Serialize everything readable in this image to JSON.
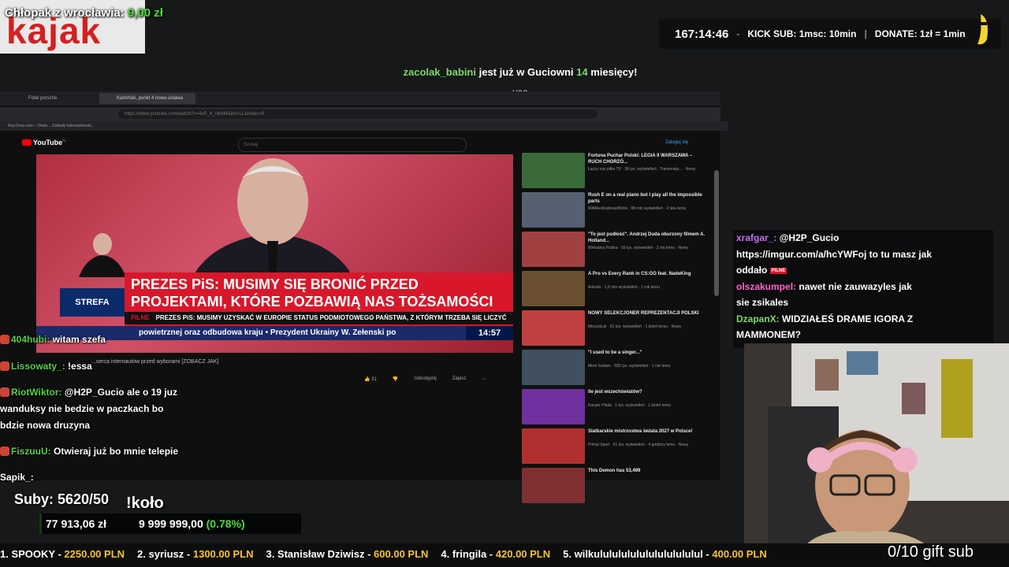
{
  "donation": {
    "logo": "kajak",
    "user": "Chłopak z wrocławia:",
    "amount": "9,00 zł"
  },
  "info_bar": {
    "timer": "167:14:46",
    "kick_sub": "KICK SUB: 1msc: 10min",
    "donate": "DONATE: 1zł = 1min"
  },
  "notification": {
    "user": "zacolak_babini",
    "text1": "jest już w Guciowni",
    "months": "14",
    "text2": "miesięcy!",
    "message": "yoo"
  },
  "browser": {
    "tabs": [
      "Fotel porsche",
      "Kamiński, punkt 4 nowa ustawa"
    ],
    "address": "https://www.youtube.com/watch?v=4oP_8_ctk4M&list=LL&index=8",
    "bookmarks": "Key-Drop.com – Otwie...   Zakłady bukmacherski...",
    "yt_logo": "YouTube",
    "yt_logo_country": "PL",
    "search_placeholder": "Szukaj",
    "login": "Zaloguj się"
  },
  "video": {
    "headline": "PREZES PiS: MUSIMY SIĘ BRONIĆ PRZED PROJEKTAMI, KTÓRE POZBAWIĄ NAS TOŻSAMOŚCI",
    "strefa": "STREFA",
    "pilne_tag": "PILNE",
    "pilne_text": "PREZES PiS: MUSIMY UZYSKAĆ W EUROPIE STATUS PODMIOTOWEGO PAŃSTWA, Z KTÓRYM TRZEBA SIĘ LICZYĆ",
    "ticker": "powietrznej oraz odbudowa kraju • Prezydent Ukrainy W. Zełenski po",
    "clock": "14:57",
    "title_below": "...serca internautów przed wyborami [ZOBACZ JAK]",
    "likes": "31",
    "share": "Udostępnij",
    "save": "Zapisz"
  },
  "sidebar": [
    {
      "title": "Fortuna Puchar Polski: LEGIA II WARSZAWA – RUCH CHORZÓ...",
      "meta": "Łączy nas piłka TV · 38 tys. wyświetleń · Transmisja... · Nowy"
    },
    {
      "title": "Rush E on a real piano but I play all the impossible parts",
      "meta": "WillAlsoKeyboardSlink · 88 mln wyświetleń · 2 lata temu"
    },
    {
      "title": "\"To jest podłość\". Andrzej Duda oburzony filmem A. Holland...",
      "meta": "Wirtualna Polska · 69 tys. wyświetleń · 2 dni temu · Nowy"
    },
    {
      "title": "A Pro vs Every Rank in CS:GO feat. NadeKing",
      "meta": "Astralis · 1,6 mln wyświetleń · 1 rok temu"
    },
    {
      "title": "NOWY SELEKCJONER REPREZENTACJI POLSKI",
      "meta": "Meczyki.pl · 51 tys. wyświetleń · 1 dzień temu · Nowy"
    },
    {
      "title": "\"I used to be a singer...\"",
      "meta": "Mere Guitars · 582 tys. wyświetleń · 1 rok temu"
    },
    {
      "title": "Ile jest wszechświatów?",
      "meta": "Kacper Pitala · 1 tys. wyświetleń · 1 dzień temu"
    },
    {
      "title": "Siatkarskie mistrzostwa świata 2027 w Polsce!",
      "meta": "Polsat Sport · 91 tys. wyświetleń · 4 godziny temu · Nowy"
    },
    {
      "title": "This Demon has 53,499",
      "meta": ""
    }
  ],
  "left_chat": [
    {
      "user": "404hubi:",
      "text": "witam szefa"
    },
    {
      "user": "Lissowaty_:",
      "text": "!essa"
    },
    {
      "user": "RiotWiktor:",
      "text": "@H2P_Gucio ale o 19 juz"
    },
    {
      "user": "",
      "text": "wanduksy nie bedzie w paczkach    bo"
    },
    {
      "user": "",
      "text": "bdzie nowa druzyna"
    },
    {
      "user": "FiszuuU:",
      "text": "Otwieraj już bo mnie telepie"
    },
    {
      "user": "Sapik_:",
      "text": ""
    }
  ],
  "right_chat": [
    {
      "user": "xrafgar_:",
      "text": "@H2P_Gucio"
    },
    {
      "user": "",
      "text": "https://imgur.com/a/hcYWFoj to tu masz jak"
    },
    {
      "user": "",
      "text": "oddało"
    },
    {
      "user": "olszakumpel:",
      "text": "nawet nie zauwazyles jak"
    },
    {
      "user": "",
      "text": "sie zsikales"
    },
    {
      "user": "DzapanX:",
      "text": "WIDZIAŁEŚ DRAME IGORA Z"
    },
    {
      "user": "",
      "text": "MAMMONEM?"
    }
  ],
  "subs": "Suby: 5620/50",
  "kolo": "!koło",
  "goal": {
    "current": "77 913,06 zł",
    "target": "9 999 999,00",
    "percent": "(0.78%)",
    "fill_fraction": 0.0078
  },
  "top_donors": [
    {
      "rank": "1. SPOOKY -",
      "amount": "2250.00 PLN"
    },
    {
      "rank": "2. syriusz -",
      "amount": "1300.00 PLN"
    },
    {
      "rank": "3. Stanisław Dziwisz -",
      "amount": "600.00 PLN"
    },
    {
      "rank": "4. fringila -",
      "amount": "420.00 PLN"
    },
    {
      "rank": "5. wilkulululululululululululul -",
      "amount": "400.00 PLN"
    }
  ],
  "gift_sub": "0/10 gift sub",
  "colors": {
    "accent_green": "#4ddc3a",
    "donor_gold": "#f4c430",
    "news_red": "#d8182a"
  }
}
